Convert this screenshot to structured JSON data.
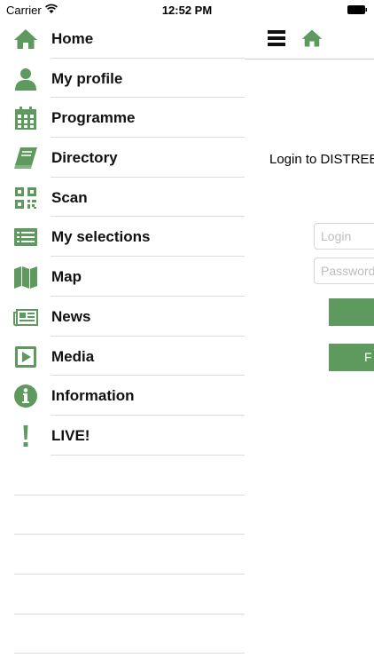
{
  "status_bar": {
    "carrier": "Carrier",
    "time": "12:52 PM"
  },
  "colors": {
    "accent": "#5e9a5e",
    "divider": "#dcdcdc"
  },
  "menu": {
    "items": [
      {
        "label": "Home",
        "icon": "home-icon"
      },
      {
        "label": "My profile",
        "icon": "person-icon"
      },
      {
        "label": "Programme",
        "icon": "calendar-icon"
      },
      {
        "label": "Directory",
        "icon": "book-icon"
      },
      {
        "label": "Scan",
        "icon": "qr-code-icon"
      },
      {
        "label": "My selections",
        "icon": "list-icon"
      },
      {
        "label": "Map",
        "icon": "map-icon"
      },
      {
        "label": "News",
        "icon": "newspaper-icon"
      },
      {
        "label": "Media",
        "icon": "play-icon"
      },
      {
        "label": "Information",
        "icon": "info-icon"
      },
      {
        "label": "LIVE!",
        "icon": "exclamation-icon"
      }
    ]
  },
  "main": {
    "login_title": "Login to DISTREE",
    "login_placeholder": "Login",
    "password_placeholder": "Password",
    "button_primary_label": "",
    "button_secondary_label": "F"
  }
}
